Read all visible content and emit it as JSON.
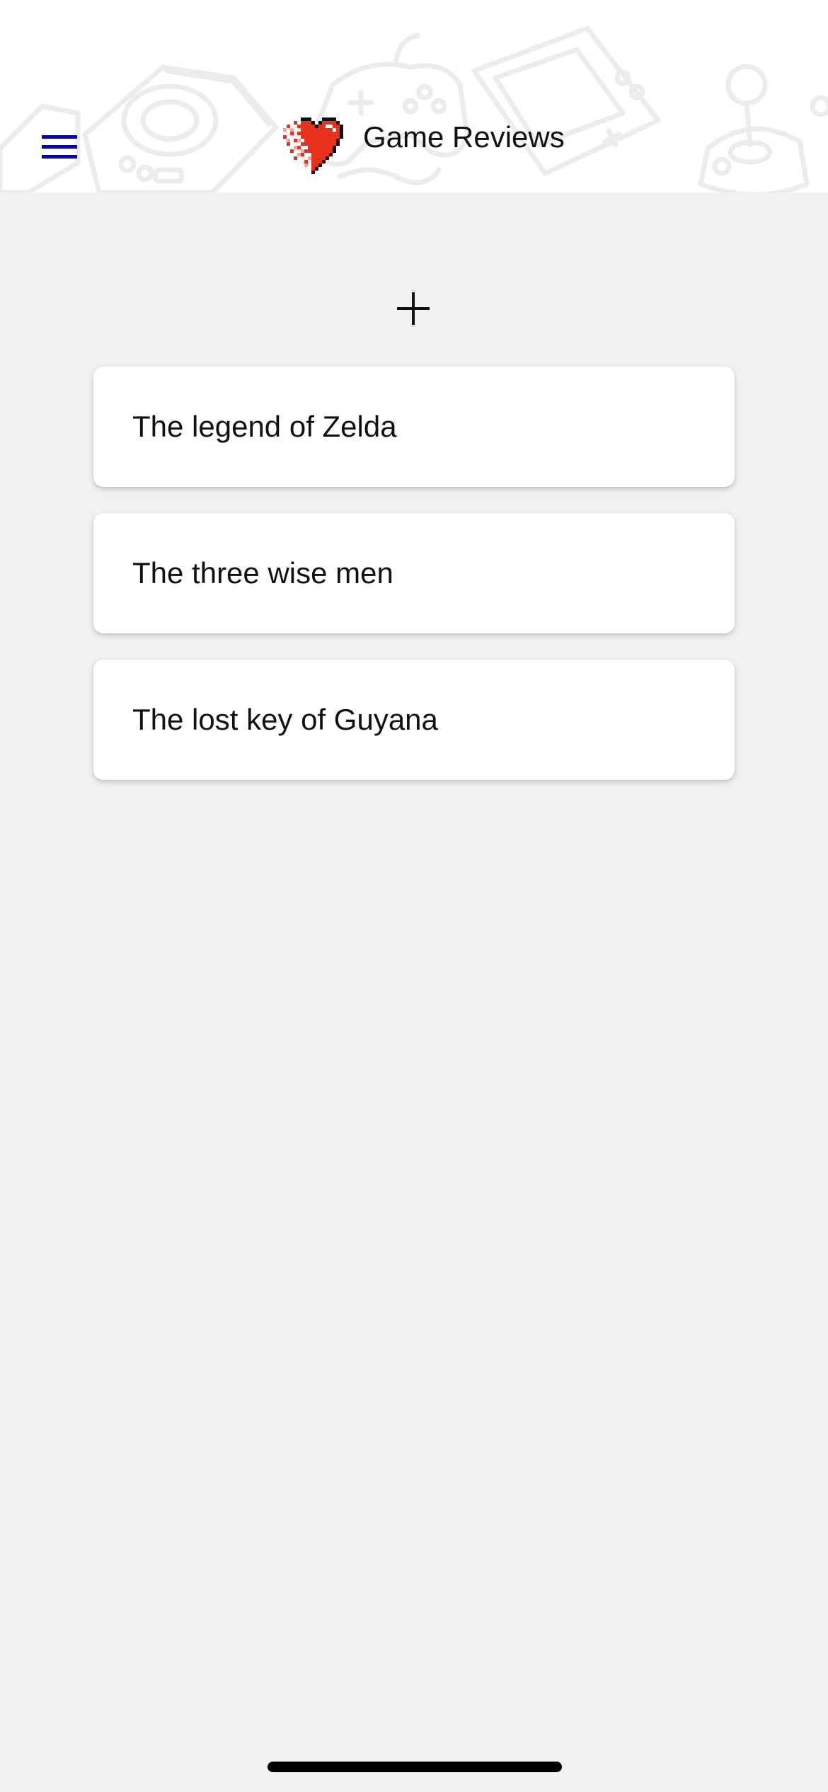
{
  "header": {
    "title": "Game Reviews",
    "menu_icon": "hamburger-menu-icon",
    "logo_icon": "pixel-heart-icon"
  },
  "actions": {
    "add_icon": "plus-icon"
  },
  "reviews": [
    {
      "title": "The legend of Zelda"
    },
    {
      "title": "The three wise men"
    },
    {
      "title": "The lost key of Guyana"
    }
  ],
  "colors": {
    "menu_icon": "#0000e0",
    "background": "#f1f1f1",
    "card": "#ffffff",
    "heart": "#e8321e",
    "text": "#111111"
  }
}
